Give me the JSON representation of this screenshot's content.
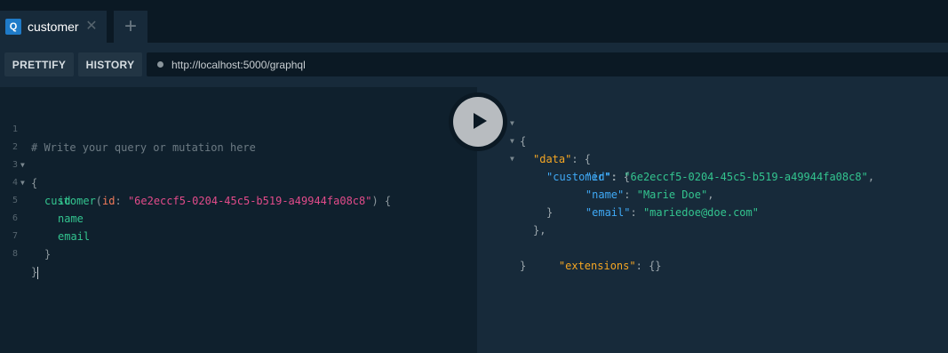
{
  "tabs": [
    {
      "badge": "Q",
      "label": "customer",
      "close": "✕"
    }
  ],
  "add_tab": "+",
  "toolbar": {
    "prettify_label": "PRETTIFY",
    "history_label": "HISTORY",
    "endpoint_url": "http://localhost:5000/graphql"
  },
  "editor": {
    "line_numbers": [
      "1",
      "2",
      "3",
      "4",
      "5",
      "6",
      "7",
      "8"
    ],
    "comment": "# Write your query or mutation here",
    "open_brace": "{",
    "query_field": "customer",
    "arg_name": "id",
    "arg_value": "\"6e2eccf5-0204-45c5-b519-a49944fa08c8\"",
    "fields": [
      "id",
      "name",
      "email"
    ],
    "close_brace": "}"
  },
  "result": {
    "key_data": "\"data\"",
    "key_customer": "\"customer\"",
    "key_id": "\"id\"",
    "val_id": "\"6e2eccf5-0204-45c5-b519-a49944fa08c8\"",
    "key_name": "\"name\"",
    "val_name": "\"Marie Doe\"",
    "key_email": "\"email\"",
    "val_email": "\"mariedoe@doe.com\"",
    "key_extensions": "\"extensions\"",
    "val_extensions": "{}"
  },
  "colors": {
    "background": "#0f202d",
    "result_background": "#172a3a",
    "field": "#33c48f",
    "argument": "#f27a5a",
    "string": "#e24b8a",
    "json_key_top": "#f5a623",
    "json_key": "#3fa9f5",
    "badge": "#1f7bc8"
  }
}
